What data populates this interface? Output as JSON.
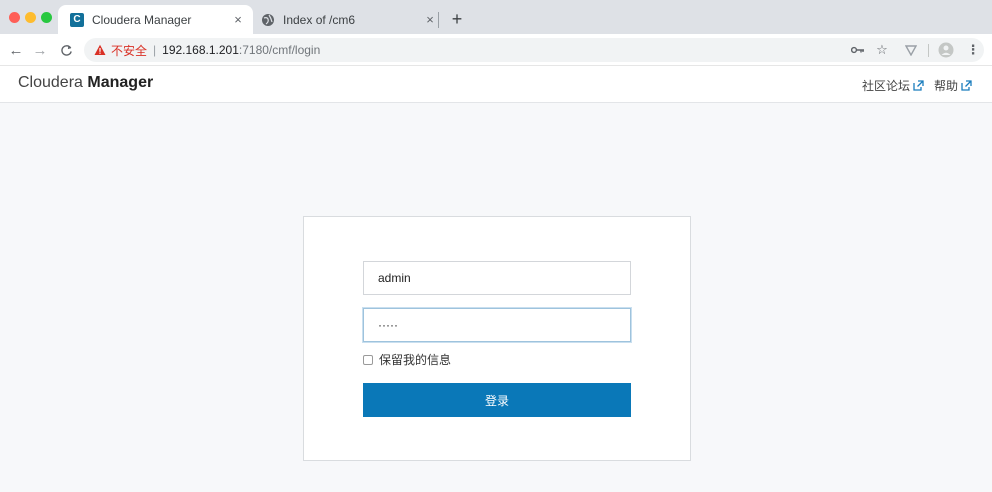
{
  "browser": {
    "tabs": [
      {
        "title": "Cloudera Manager",
        "favicon_letter": "C",
        "active": true
      },
      {
        "title": "Index of /cm6",
        "active": false
      }
    ],
    "tab_close_glyph": "×",
    "new_tab_glyph": "+",
    "address": {
      "security_label": "不安全",
      "separator": "|",
      "host": "192.168.1.201",
      "path": ":7180/cmf/login"
    }
  },
  "header": {
    "brand_light": "Cloudera",
    "brand_bold": "Manager",
    "links": [
      {
        "label": "社区论坛"
      },
      {
        "label": "帮助"
      }
    ]
  },
  "login": {
    "username_value": "admin",
    "password_value": "·····",
    "remember_label": "保留我的信息",
    "remember_checked": false,
    "submit_label": "登录"
  },
  "colors": {
    "accent": "#0a78b8",
    "insecure_red": "#d93025",
    "brand_favicon": "#12709a"
  }
}
